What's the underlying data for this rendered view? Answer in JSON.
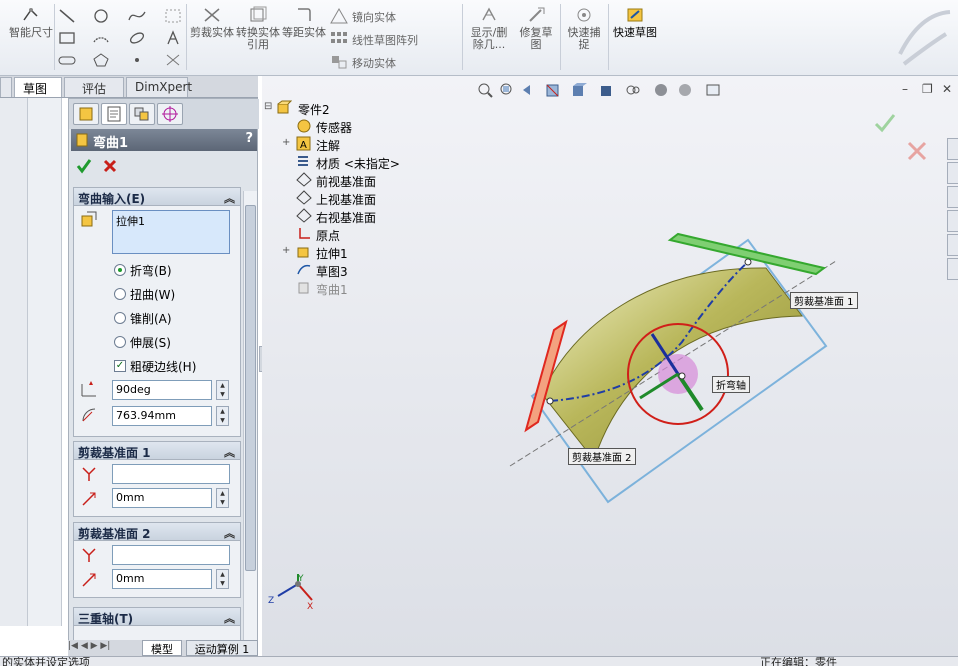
{
  "ribbon": {
    "smart_dim": "智能尺寸",
    "trim": "剪裁实体",
    "convert": "转换实体引用",
    "offset": "等距实体",
    "mirror": "镜向实体",
    "linear_pattern": "线性草图阵列",
    "move": "移动实体",
    "show_delete": "显示/删除几...",
    "repair": "修复草图",
    "quick_snap": "快速捕捉",
    "rapid_sketch": "快速草图"
  },
  "tabs": [
    "草图",
    "评估",
    "DimXpert"
  ],
  "property_manager": {
    "title": "弯曲1",
    "help": "?",
    "ok_icon": "check-icon",
    "cancel_icon": "cross-icon",
    "bend_input": {
      "heading": "弯曲输入(E)",
      "body": "拉伸1",
      "options": [
        "折弯(B)",
        "扭曲(W)",
        "锥削(A)",
        "伸展(S)"
      ],
      "selected": "折弯(B)",
      "hard_edges_label": "粗硬边线(H)",
      "hard_edges_checked": true,
      "angle": "90deg",
      "radius": "763.94mm"
    },
    "trim_plane_1": {
      "heading": "剪裁基准面 1",
      "entity": "",
      "offset": "0mm"
    },
    "trim_plane_2": {
      "heading": "剪裁基准面 2",
      "entity": "",
      "offset": "0mm"
    },
    "triad": {
      "heading": "三重轴(T)"
    }
  },
  "tree": {
    "root": "零件2",
    "items": [
      "传感器",
      "注解",
      "材质 <未指定>",
      "前视基准面",
      "上视基准面",
      "右视基准面",
      "原点",
      "拉伸1",
      "草图3",
      "弯曲1"
    ]
  },
  "callouts": {
    "trim_plane_1": "剪裁基准面 1",
    "trim_plane_2": "剪裁基准面 2",
    "bend_axis": "折弯轴"
  },
  "bottom_tabs": [
    "模型",
    "运动算例 1"
  ],
  "status": {
    "left": "的实体并设定选项",
    "right": "正在编辑：零件"
  },
  "triad_labels": {
    "x": "X",
    "y": "Y",
    "z": "Z"
  },
  "colors": {
    "accent": "#1f57a6",
    "pm_title": "#6a7585",
    "model_body": "#b8b65a",
    "trim_plane_red": "#e0281f",
    "trim_plane_green": "#35a82f"
  }
}
